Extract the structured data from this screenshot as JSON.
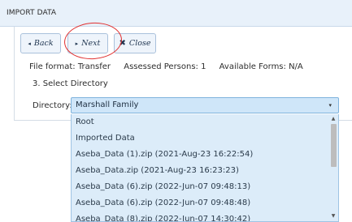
{
  "header": {
    "title": "IMPORT DATA"
  },
  "toolbar": {
    "back_label": "Back",
    "next_label": "Next",
    "close_label": "Close",
    "back_icon": "◂",
    "next_icon": "▸",
    "close_icon": "✖"
  },
  "info": {
    "file_format": "File format: Transfer",
    "assessed_persons": "Assessed Persons: 1",
    "available_forms": "Available Forms: N/A"
  },
  "step": {
    "label": "3. Select Directory"
  },
  "directory": {
    "label": "Directory:",
    "selected": "Marshall Family",
    "arrow": "▾",
    "options": [
      "Root",
      "Imported Data",
      "Aseba_Data (1).zip (2021-Aug-23 16:22:54)",
      "Aseba_Data.zip (2021-Aug-23 16:23:23)",
      "Aseba_Data (6).zip (2022-Jun-07 09:48:13)",
      "Aseba_Data (6).zip (2022-Jun-07 09:48:48)",
      "Aseba_Data (8).zip (2022-Jun-07 14:30:42)"
    ]
  },
  "scrollbar": {
    "up": "▲",
    "down": "▼"
  },
  "colors": {
    "header_bg": "#e8f1fa",
    "select_bg": "#cfe6f9",
    "dropdown_bg": "#dcecf9",
    "annotation_circle": "#e03030"
  }
}
